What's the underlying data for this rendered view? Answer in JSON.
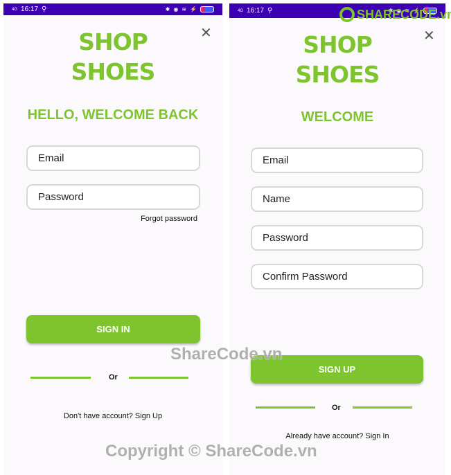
{
  "status": {
    "time": "16:17",
    "network": "4G"
  },
  "brand_color": "#7dc42f",
  "status_color": "#3d00b3",
  "login": {
    "logo_line1": "SHOP",
    "logo_line2": "SHOES",
    "title": "HELLO, WELCOME BACK",
    "email_placeholder": "Email",
    "password_placeholder": "Password",
    "forgot": "Forgot password",
    "button": "SIGN IN",
    "or": "Or",
    "footer": "Don't have account? Sign Up",
    "close_icon": "close-icon"
  },
  "signup": {
    "logo_line1": "SHOP",
    "logo_line2": "SHOES",
    "title": "WELCOME",
    "email_placeholder": "Email",
    "name_placeholder": "Name",
    "password_placeholder": "Password",
    "confirm_placeholder": "Confirm Password",
    "button": "SIGN UP",
    "or": "Or",
    "footer": "Already have account? Sign In",
    "close_icon": "close-icon"
  },
  "watermarks": {
    "logo": "SHARECODE.vn",
    "center": "ShareCode.vn",
    "copyright": "Copyright © ShareCode.vn"
  }
}
